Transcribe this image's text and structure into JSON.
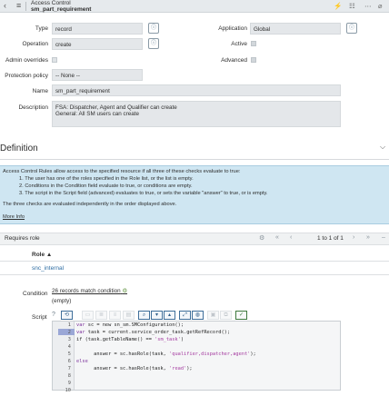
{
  "header": {
    "title": "Access Control",
    "subtitle": "sm_part_requirement"
  },
  "form": {
    "type_label": "Type",
    "type_value": "record",
    "application_label": "Application",
    "application_value": "Global",
    "operation_label": "Operation",
    "operation_value": "create",
    "active_label": "Active",
    "admin_overrides_label": "Admin overrides",
    "advanced_label": "Advanced",
    "protection_label": "Protection policy",
    "protection_value": "-- None --",
    "name_label": "Name",
    "name_value": "sm_part_requirement",
    "description_label": "Description",
    "description_line1": "FSA: Dispatcher, Agent and Qualifier can create",
    "description_line2": "General: All SM users can create"
  },
  "definition": {
    "title": "Definition",
    "intro": "Access Control Rules allow access to the specified resource if all three of these checks evaluate to true:",
    "items": [
      "1. The user has one of the roles specified in the Role list, or the list is empty.",
      "2. Conditions in the Condition field evaluate to true, or conditions are empty.",
      "3. The script in the Script field (advanced) evaluates to true, or sets the variable \"answer\" to true, or is empty."
    ],
    "note": "The three checks are evaluated independently in the order displayed above.",
    "more_info": "More Info"
  },
  "requires_role": {
    "title": "Requires role",
    "pagination": "1   to 1 of 1",
    "column_header": "Role ▲",
    "rows": [
      "snc_internal"
    ]
  },
  "condition": {
    "label": "Condition",
    "link": "26 records match condition",
    "value": "(empty)"
  },
  "script": {
    "label": "Script",
    "line_numbers": [
      "1",
      "2",
      "3",
      "4",
      "5",
      "6",
      "7",
      "8",
      "9",
      "10"
    ],
    "code": {
      "l1_kw": "var",
      "l1_rest": " sc = new sn_sm.SMConfiguration();",
      "l2_kw": "var",
      "l2_rest": " task = current.service_order_task.getRefRecord();",
      "l3_a": "if (task.getTableName() == ",
      "l3_str": "'sm_task'",
      "l3_b": ")",
      "l4": "",
      "l5_a": "      answer = sc.hasRole(task, ",
      "l5_str": "'qualifier,dispatcher,agent'",
      "l5_b": ");",
      "l6_kw": "else",
      "l7_a": "      answer = sc.hasRole(task, ",
      "l7_str": "'read'",
      "l7_b": ");"
    }
  },
  "colors": {
    "header_bg": "#e6eaed",
    "field_bg": "#e4e7ea",
    "info_bg": "#cfe6f2",
    "link": "#2d6ca2"
  }
}
